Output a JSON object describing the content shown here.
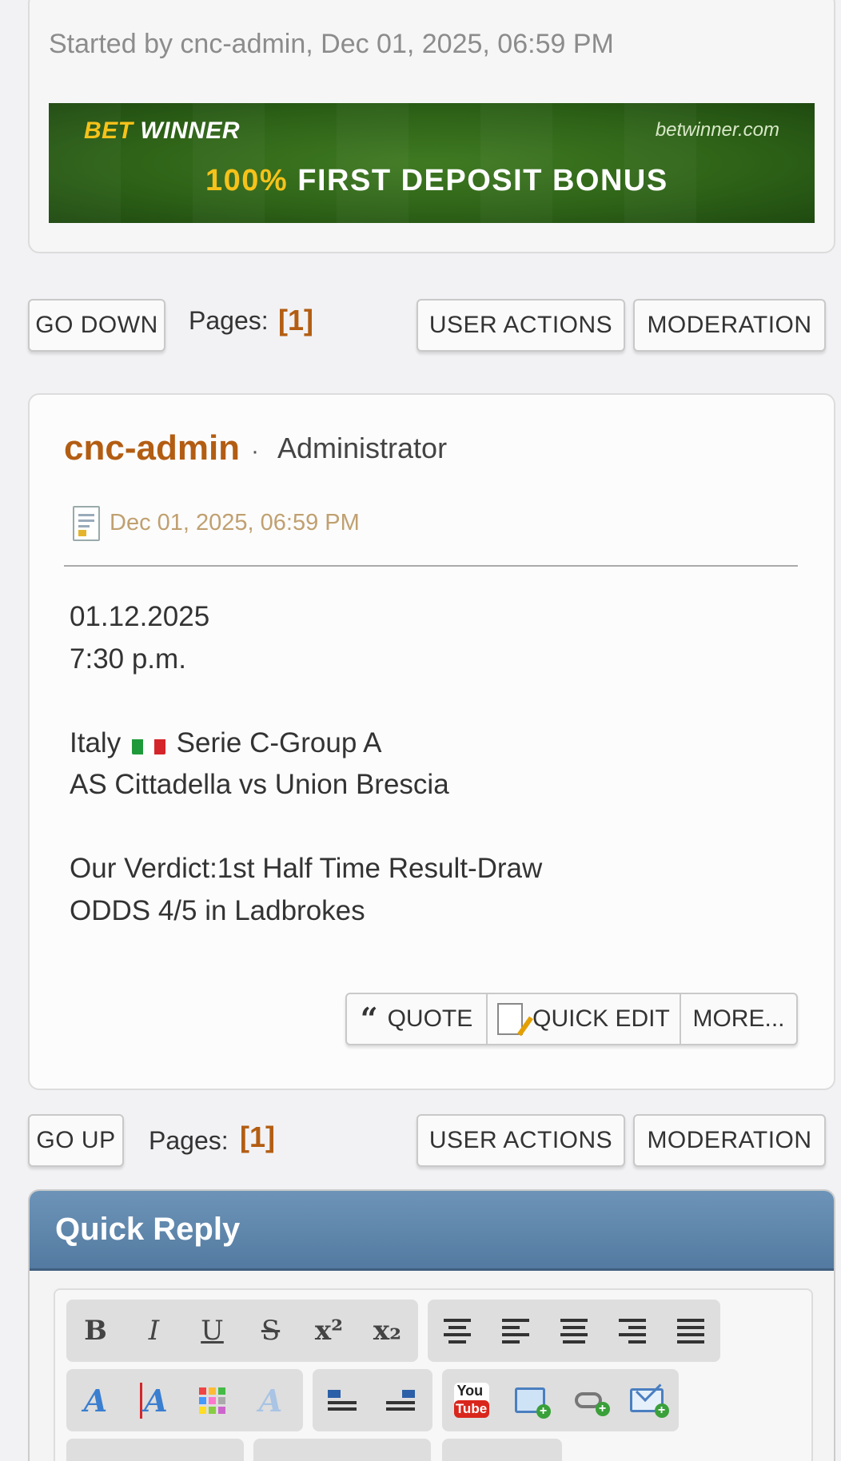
{
  "topic": {
    "started_by": "Started by cnc-admin, Dec 01, 2025, 06:59 PM"
  },
  "banner": {
    "brand_bet": "BET",
    "brand_winner": "WINNER",
    "site": "betwinner.com",
    "percent": "100%",
    "headline": "FIRST DEPOSIT BONUS"
  },
  "top_nav": {
    "go_down": "GO DOWN",
    "pages_label": "Pages:",
    "pages_num": "[1]",
    "user_actions": "USER ACTIONS",
    "moderation": "MODERATION"
  },
  "post": {
    "author": "cnc-admin",
    "separator": "·",
    "role": "Administrator",
    "timestamp": "Dec 01, 2025, 06:59 PM",
    "lines": [
      "01.12.2025",
      "7:30 p.m.",
      "",
      "Italy",
      "Serie C-Group A",
      "AS Cittadella vs Union Brescia",
      "",
      "Our Verdict:1st Half Time Result-Draw",
      "ODDS 4/5 in Ladbrokes"
    ],
    "actions": {
      "quote_mark": "“",
      "quote": "QUOTE",
      "quick_edit": "QUICK EDIT",
      "more": "MORE..."
    }
  },
  "bottom_nav": {
    "go_up": "GO UP",
    "pages_label": "Pages:",
    "pages_num": "[1]",
    "user_actions": "USER ACTIONS",
    "moderation": "MODERATION"
  },
  "quick_reply": {
    "title": "Quick Reply",
    "toolbar": {
      "bold": "B",
      "italic": "I",
      "underline": "U",
      "strike": "S",
      "sup": "x²",
      "sub": "x₂",
      "youtube_top": "You",
      "youtube_bottom": "Tube",
      "font_a": "A"
    }
  },
  "colors": {
    "accent": "#b35d12",
    "header_blue": "#5f86ac",
    "timestamp": "#c0a070",
    "flag_green": "#1f9a3a",
    "flag_red": "#d4252a"
  },
  "icons": [
    "document-icon",
    "quote-icon",
    "edit-icon",
    "youtube-icon",
    "image-icon",
    "link-icon",
    "email-icon",
    "italy-flag-icon"
  ]
}
